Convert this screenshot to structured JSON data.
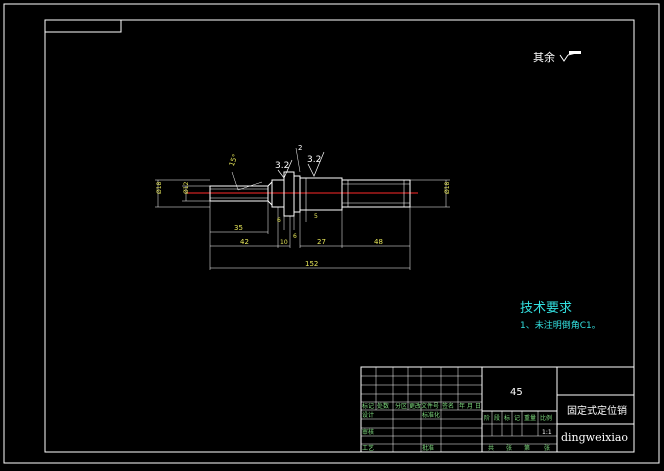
{
  "colors": {
    "background": "#000000",
    "border": "#ffffff",
    "dimension": "#7fdc7f",
    "note": "#33e0e0",
    "centerline": "#ff2a2a",
    "annotation": "#e8e85a"
  },
  "surface_note": {
    "text": "其余",
    "symbol": "surface-finish-triangle-icon"
  },
  "dimensions": {
    "d_left": "Ø18",
    "d_inner": "Ø12",
    "d_right": "Ø18",
    "angle": "15°",
    "rough1": "3.2",
    "rough2": "3.2",
    "small_top": "2",
    "len_35": "35",
    "len_42": "42",
    "len_10": "10",
    "len_27": "27",
    "len_48": "48",
    "len_6a": "6",
    "len_6b": "6",
    "len_5": "5",
    "total": "152"
  },
  "tech_req": {
    "title": "技术要求",
    "item1": "1、未注明倒角C1。"
  },
  "title_block": {
    "material": "45",
    "part_name": "固定式定位销",
    "scale": "1:1",
    "company": "dingweixiao",
    "sig_row": [
      "标记",
      "处数",
      "分区",
      "更改文件号",
      "签名",
      "年",
      "月",
      "日"
    ],
    "design": "设计",
    "standard": "标准化",
    "review": "审核",
    "process": "工艺",
    "approve": "批准",
    "stage_row": [
      "阶",
      "段",
      "标",
      "记",
      "重量",
      "比例"
    ],
    "sheet_row": [
      "共",
      "张",
      "第",
      "张"
    ]
  }
}
